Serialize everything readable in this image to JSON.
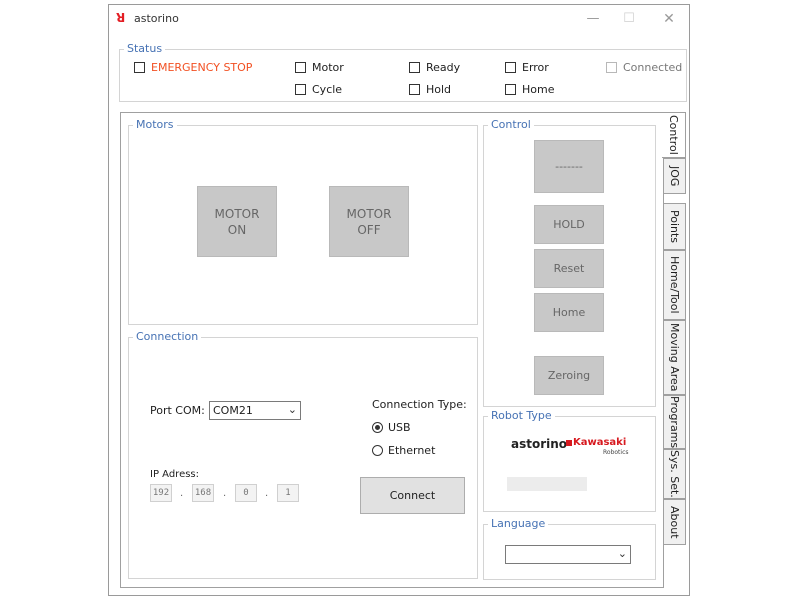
{
  "window": {
    "title": "astorino",
    "logo_glyph": "ꓤ",
    "minimize": "—",
    "maximize": "☐",
    "close": "✕"
  },
  "status": {
    "label": "Status",
    "emergency_stop": "EMERGENCY STOP",
    "motor": "Motor",
    "ready": "Ready",
    "error": "Error",
    "connected": "Connected",
    "cycle": "Cycle",
    "hold": "Hold",
    "home": "Home"
  },
  "motors": {
    "label": "Motors",
    "motor_on": "MOTOR\nON",
    "motor_off": "MOTOR\nOFF"
  },
  "control": {
    "label": "Control",
    "top_button": "-------",
    "hold": "HOLD",
    "reset": "Reset",
    "home": "Home",
    "zeroing": "Zeroing"
  },
  "connection": {
    "label": "Connection",
    "port_label": "Port COM:",
    "port_value": "COM21",
    "type_label": "Connection Type:",
    "usb": "USB",
    "ethernet": "Ethernet",
    "selected_type": "USB",
    "ip_label": "IP Adress:",
    "ip": [
      "192",
      "168",
      "0",
      "1"
    ],
    "ip_sep": ".",
    "connect": "Connect"
  },
  "robot_type": {
    "label": "Robot Type",
    "brand": "astorino",
    "maker": "Kawasaki",
    "maker_sub": "Robotics"
  },
  "language": {
    "label": "Language",
    "value": ""
  },
  "tabs": [
    "Control",
    "JOG",
    "Points",
    "Home/Tool",
    "Moving Area",
    "Programs",
    "Sys. Set.",
    "About"
  ],
  "colors": {
    "group_label": "#4672b4",
    "emergency": "#f25022",
    "button_gray": "#c8c8c8",
    "kawasaki_red": "#d7191f"
  }
}
